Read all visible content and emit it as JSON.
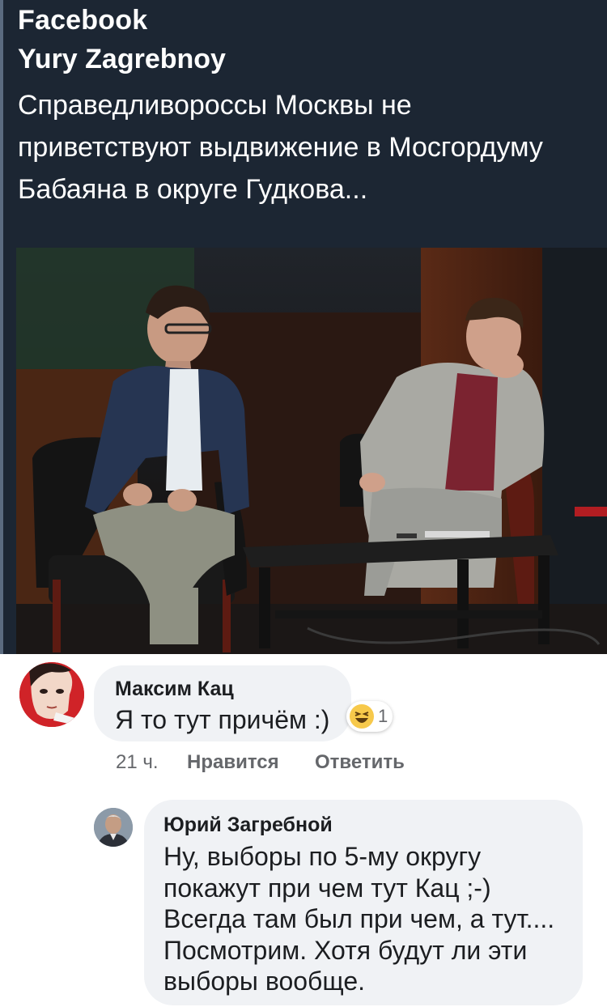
{
  "preview": {
    "source": "Facebook",
    "author": "Yury Zagrebnoy",
    "text": "Справедливороссы Москвы не приветствуют выдвижение в Мосгордуму Бабаяна в округе Гудкова..."
  },
  "comments": [
    {
      "author": "Максим Кац",
      "text": "Я то тут причём :)",
      "reaction": {
        "icon": "laughing-emoji-icon",
        "count": "1"
      },
      "time": "21 ч.",
      "like_label": "Нравится",
      "reply_label": "Ответить"
    },
    {
      "author": "Юрий Загребной",
      "text": "Ну, выборы по 5-му округу покажут при чем тут Кац ;-) Всегда там был при чем, а тут.... Посмотрим. Хотя будут ли эти выборы вообще."
    }
  ],
  "colors": {
    "preview_bg": "#1c2633",
    "bubble_bg": "#f0f2f5",
    "meta_text": "#65676b"
  }
}
